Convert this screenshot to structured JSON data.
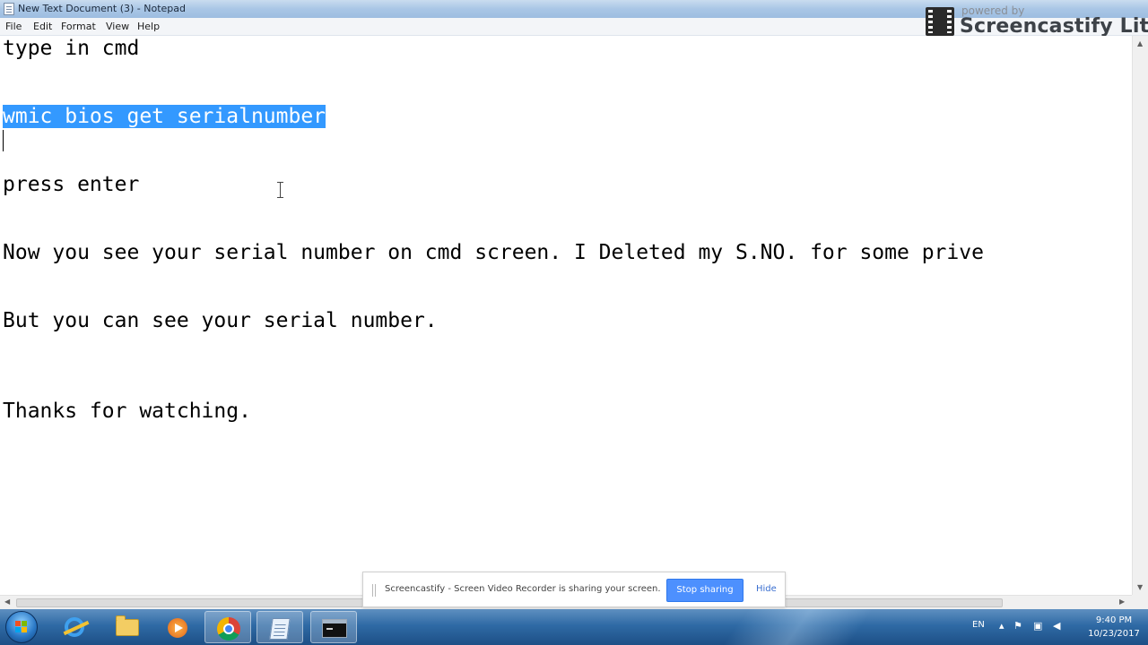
{
  "window": {
    "title": "New Text Document (3) - Notepad"
  },
  "menu": {
    "items": [
      "File",
      "Edit",
      "Format",
      "View",
      "Help"
    ]
  },
  "watermark": {
    "powered_by": "powered by",
    "brand": "Screencastify Lite"
  },
  "editor": {
    "lines": [
      "type in cmd",
      "wmic bios get serialnumber",
      "press enter",
      "Now you see your serial number on cmd screen. I Deleted my S.NO. for some prive",
      "But you can see your serial number.",
      "Thanks for watching."
    ],
    "selection_color": "#3399ff"
  },
  "share_notification": {
    "message": "Screencastify - Screen Video Recorder is sharing your screen.",
    "stop_button": "Stop sharing",
    "hide_link": "Hide"
  },
  "taskbar": {
    "pinned": [
      "start-orb",
      "internet-explorer-icon",
      "file-explorer-icon",
      "media-player-icon",
      "chrome-icon",
      "notepad-icon",
      "cmd-icon"
    ],
    "tray": {
      "language": "EN",
      "time": "9:40 PM",
      "date": "10/23/2017"
    }
  }
}
